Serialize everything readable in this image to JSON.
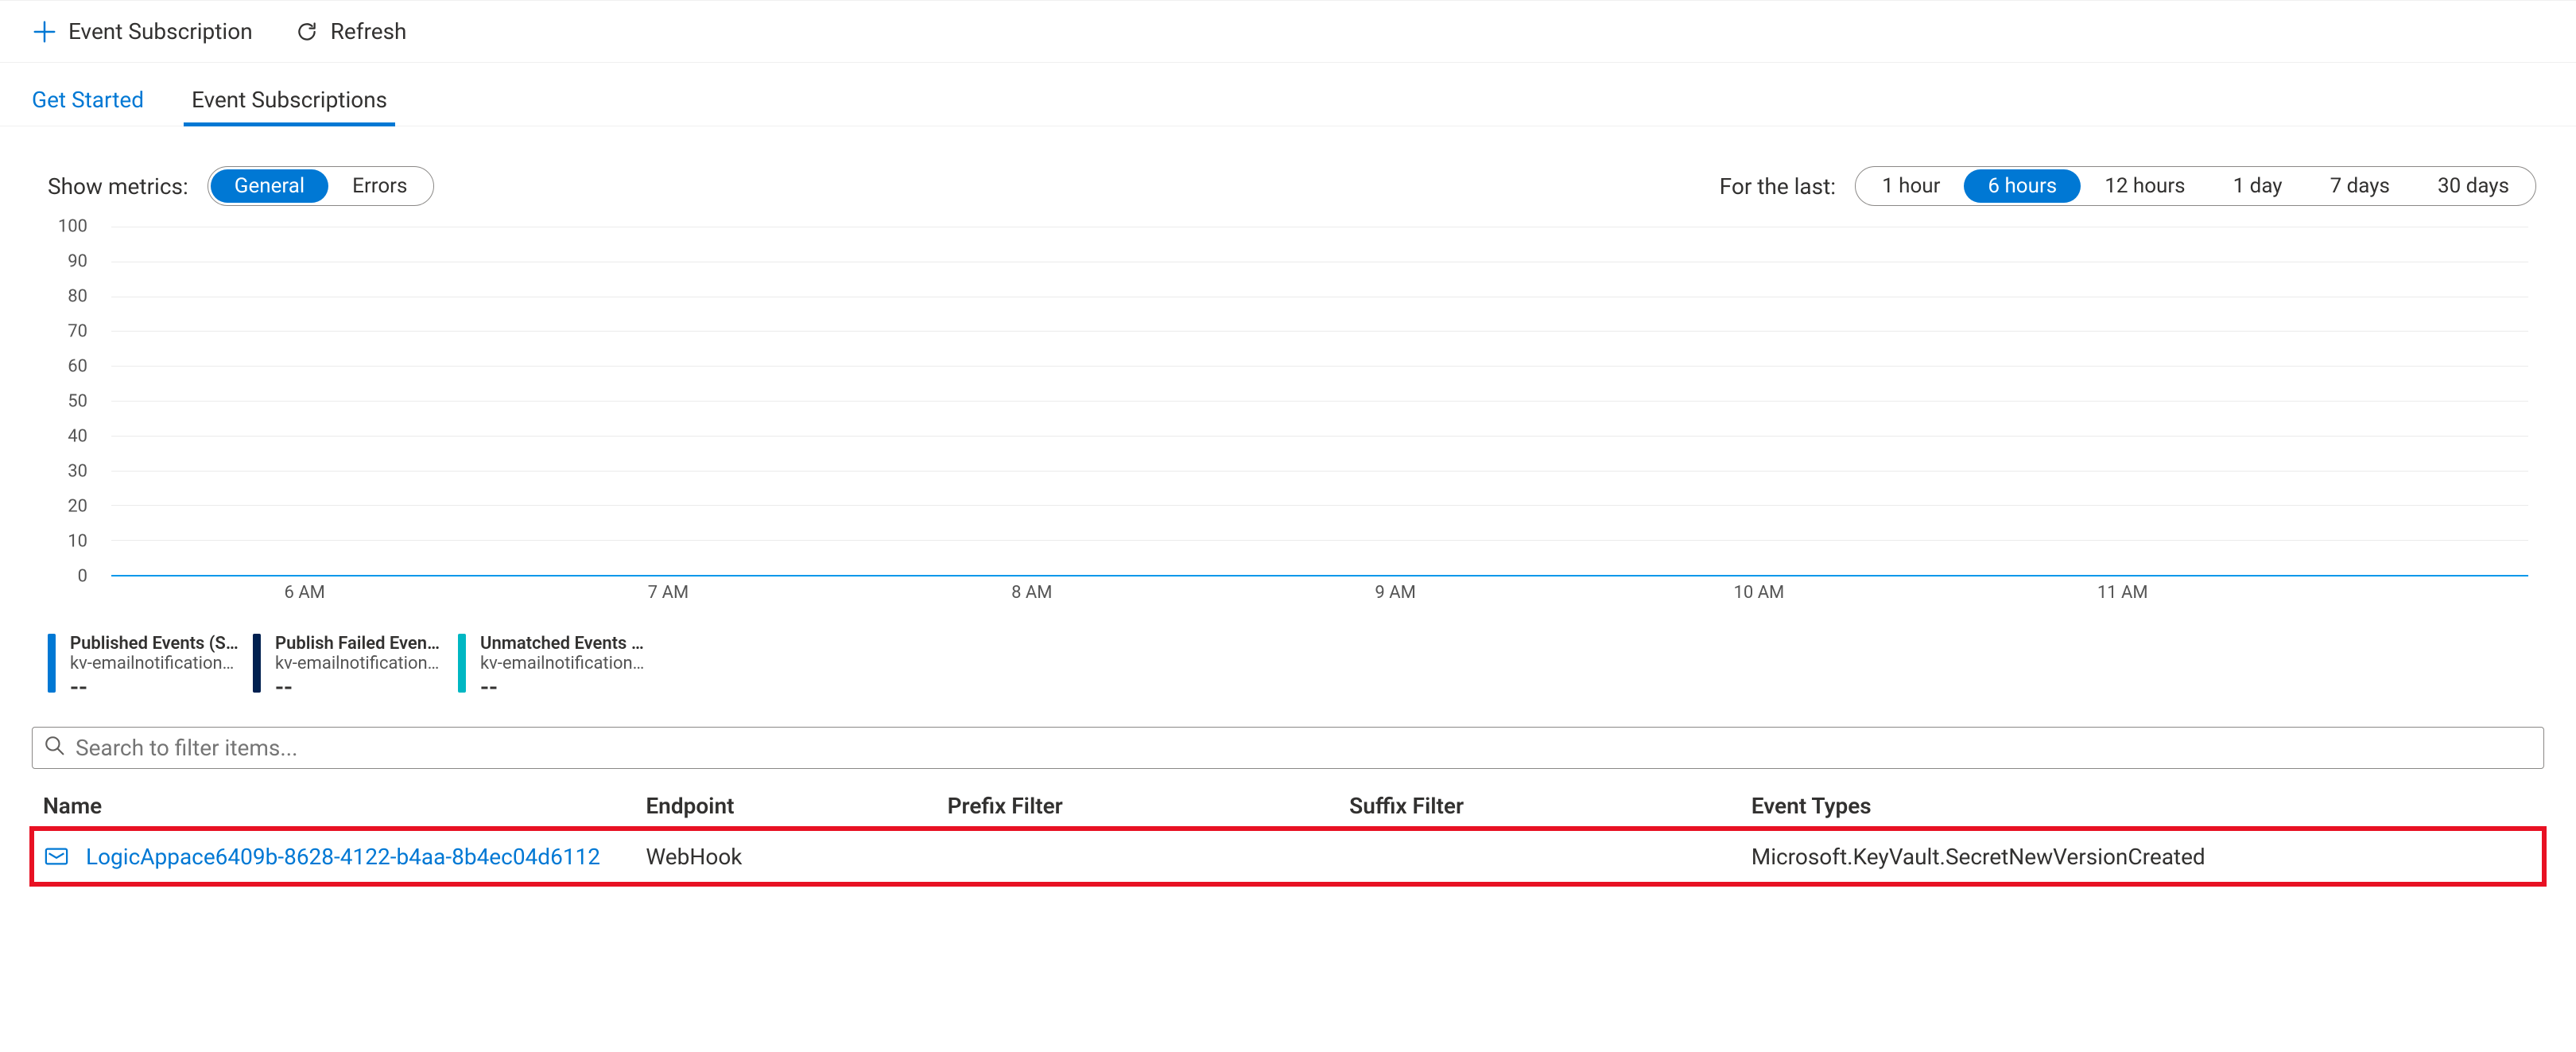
{
  "toolbar": {
    "event_subscription_label": "Event Subscription",
    "refresh_label": "Refresh"
  },
  "tabs": {
    "get_started": "Get Started",
    "event_subscriptions": "Event Subscriptions",
    "active": "event_subscriptions"
  },
  "filters": {
    "metrics_label": "Show metrics:",
    "metrics_options": {
      "general": "General",
      "errors": "Errors"
    },
    "metrics_selected": "general",
    "range_label": "For the last:",
    "range_options": {
      "h1": "1 hour",
      "h6": "6 hours",
      "h12": "12 hours",
      "d1": "1 day",
      "d7": "7 days",
      "d30": "30 days"
    },
    "range_selected": "h6"
  },
  "chart_data": {
    "type": "line",
    "title": "",
    "xlabel": "",
    "ylabel": "",
    "ylim": [
      0,
      100
    ],
    "y_ticks": [
      0,
      10,
      20,
      30,
      40,
      50,
      60,
      70,
      80,
      90,
      100
    ],
    "x_categories": [
      "6 AM",
      "7 AM",
      "8 AM",
      "9 AM",
      "10 AM",
      "11 AM"
    ],
    "series": [
      {
        "name": "Published Events (Sum)",
        "source": "kv-emailnotification…",
        "color": "#0078d4",
        "value_display": "--",
        "values": [
          0,
          0,
          0,
          0,
          0,
          0
        ]
      },
      {
        "name": "Publish Failed Event…",
        "source": "kv-emailnotification…",
        "color": "#002050",
        "value_display": "--",
        "values": [
          0,
          0,
          0,
          0,
          0,
          0
        ]
      },
      {
        "name": "Unmatched Events (Sum)",
        "source": "kv-emailnotification…",
        "color": "#00b7c3",
        "value_display": "--",
        "values": [
          0,
          0,
          0,
          0,
          0,
          0
        ]
      }
    ]
  },
  "search": {
    "placeholder": "Search to filter items..."
  },
  "table": {
    "columns": {
      "name": "Name",
      "endpoint": "Endpoint",
      "prefix": "Prefix Filter",
      "suffix": "Suffix Filter",
      "types": "Event Types"
    },
    "rows": [
      {
        "name": "LogicAppace6409b-8628-4122-b4aa-8b4ec04d6112",
        "endpoint": "WebHook",
        "prefix": "",
        "suffix": "",
        "types": "Microsoft.KeyVault.SecretNewVersionCreated",
        "highlight": true
      }
    ]
  }
}
